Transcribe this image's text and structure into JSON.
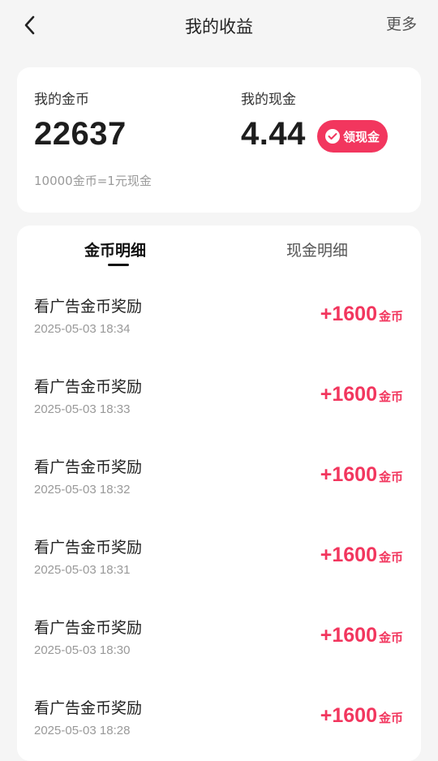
{
  "header": {
    "title": "我的收益",
    "more_label": "更多"
  },
  "balance": {
    "coins_label": "我的金币",
    "coins_value": "22637",
    "cash_label": "我的现金",
    "cash_value": "4.44",
    "withdraw_label": "领现金",
    "rate_note": "10000金币=1元现金"
  },
  "tabs": [
    {
      "label": "金币明细",
      "active": true
    },
    {
      "label": "现金明细",
      "active": false
    }
  ],
  "records": [
    {
      "title": "看广告金币奖励",
      "time": "2025-05-03 18:34",
      "amount": "+1600",
      "unit": "金币"
    },
    {
      "title": "看广告金币奖励",
      "time": "2025-05-03 18:33",
      "amount": "+1600",
      "unit": "金币"
    },
    {
      "title": "看广告金币奖励",
      "time": "2025-05-03 18:32",
      "amount": "+1600",
      "unit": "金币"
    },
    {
      "title": "看广告金币奖励",
      "time": "2025-05-03 18:31",
      "amount": "+1600",
      "unit": "金币"
    },
    {
      "title": "看广告金币奖励",
      "time": "2025-05-03 18:30",
      "amount": "+1600",
      "unit": "金币"
    },
    {
      "title": "看广告金币奖励",
      "time": "2025-05-03 18:28",
      "amount": "+1600",
      "unit": "金币"
    }
  ],
  "colors": {
    "accent": "#f2365e",
    "background": "#f5f5f5",
    "card": "#ffffff"
  },
  "icons": {
    "back": "chevron-left-icon",
    "withdraw": "wechat-pay-icon"
  }
}
